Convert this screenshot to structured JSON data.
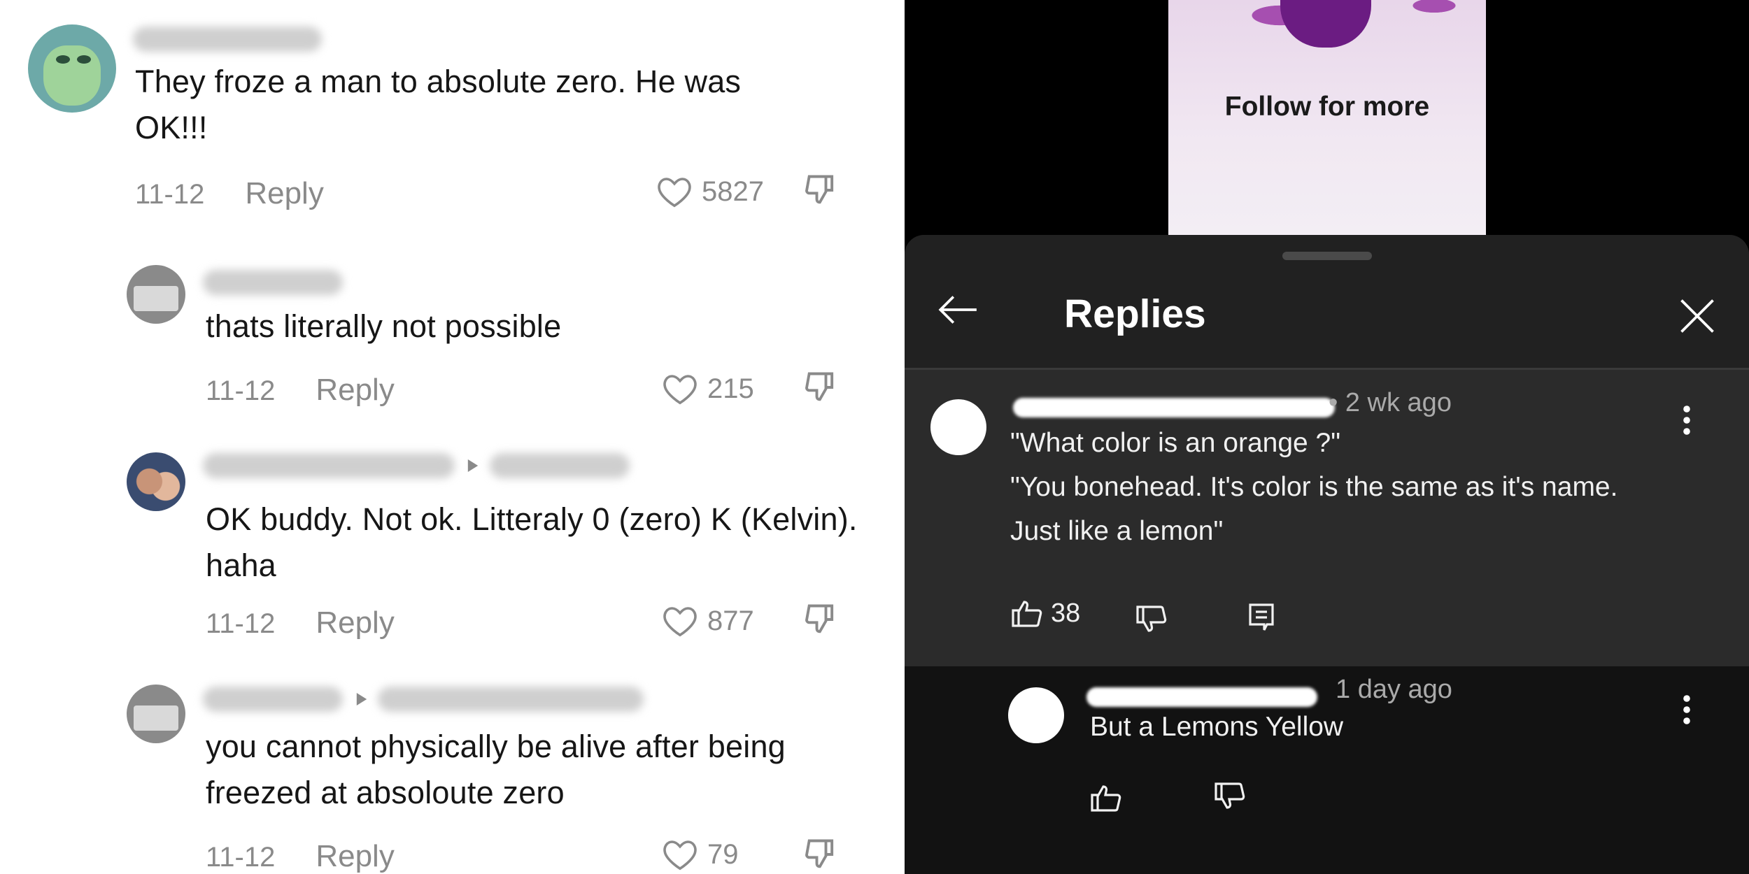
{
  "left": {
    "comments": [
      {
        "text": "They froze a man to absolute zero. He was OK!!!",
        "date": "11-12",
        "reply": "Reply",
        "likes": "5827"
      },
      {
        "text": "thats literally not possible",
        "date": "11-12",
        "reply": "Reply",
        "likes": "215"
      },
      {
        "text": "OK buddy. Not ok. Litteraly 0 (zero) K (Kelvin). haha",
        "date": "11-12",
        "reply": "Reply",
        "likes": "877"
      },
      {
        "text": "you cannot physically be alive after being freezed at absoloute zero",
        "date": "11-12",
        "reply": "Reply",
        "likes": "79"
      }
    ]
  },
  "right": {
    "thumbnail_text": "Follow for more",
    "title": "Replies",
    "parent": {
      "time": "• 2 wk ago",
      "text_lines": [
        "\"What color is an orange ?\"",
        "\"You bonehead. It's color is the same as it's name.",
        "Just like a lemon\""
      ],
      "likes": "38"
    },
    "reply": {
      "time": "1 day ago",
      "text": "But a Lemons Yellow"
    }
  },
  "colors": {
    "dark_bg": "#212121",
    "parent_bg": "#2b2b2b",
    "reply_bg": "#121212",
    "muted": "#8a8a8a"
  }
}
